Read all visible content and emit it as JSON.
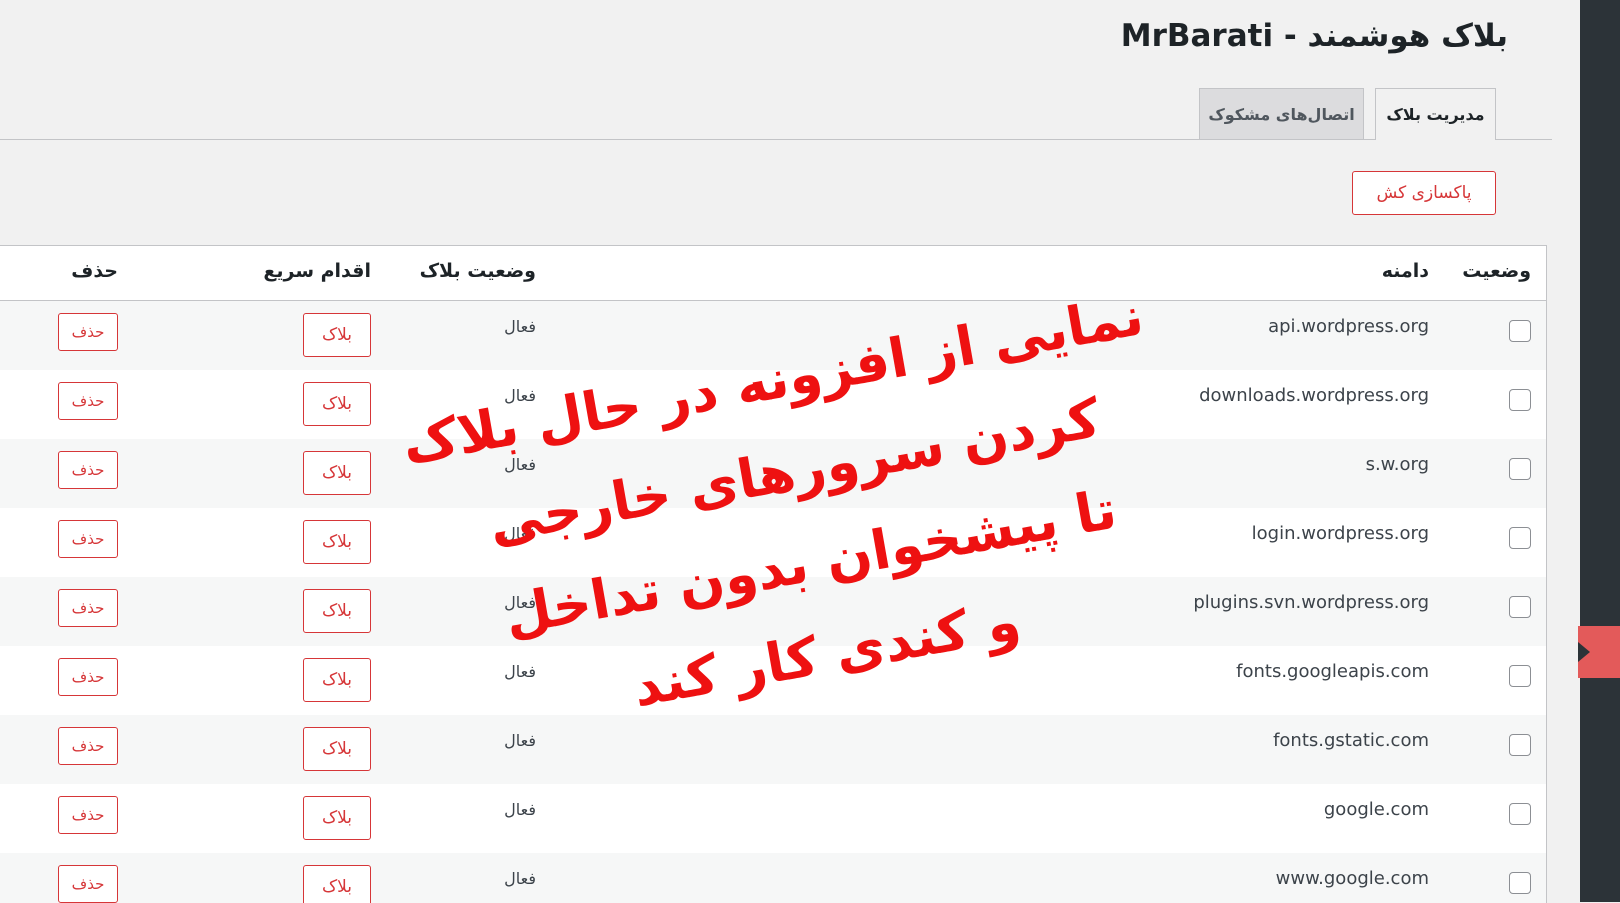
{
  "header": {
    "title": "بلاک هوشمند - MrBarati"
  },
  "tabs": [
    {
      "label": "مدیریت بلاک",
      "active": true
    },
    {
      "label": "اتصال‌های مشکوک",
      "active": false
    }
  ],
  "actions": {
    "purge_cache": "پاکسازی کش"
  },
  "table": {
    "columns": {
      "status": "وضعیت",
      "domain": "دامنه",
      "block_status": "وضعیت بلاک",
      "quick_action": "اقدام سریع",
      "delete": "حذف"
    },
    "rows": [
      {
        "domain": "api.wordpress.org",
        "block_status": "فعال",
        "action": "بلاک",
        "delete": "حذف"
      },
      {
        "domain": "downloads.wordpress.org",
        "block_status": "فعال",
        "action": "بلاک",
        "delete": "حذف"
      },
      {
        "domain": "s.w.org",
        "block_status": "فعال",
        "action": "بلاک",
        "delete": "حذف"
      },
      {
        "domain": "login.wordpress.org",
        "block_status": "فعال",
        "action": "بلاک",
        "delete": "حذف"
      },
      {
        "domain": "plugins.svn.wordpress.org",
        "block_status": "فعال",
        "action": "بلاک",
        "delete": "حذف"
      },
      {
        "domain": "fonts.googleapis.com",
        "block_status": "فعال",
        "action": "بلاک",
        "delete": "حذف"
      },
      {
        "domain": "fonts.gstatic.com",
        "block_status": "فعال",
        "action": "بلاک",
        "delete": "حذف"
      },
      {
        "domain": "google.com",
        "block_status": "فعال",
        "action": "بلاک",
        "delete": "حذف"
      },
      {
        "domain": "www.google.com",
        "block_status": "فعال",
        "action": "بلاک",
        "delete": "حذف"
      }
    ]
  },
  "overlay_caption": {
    "lines": [
      "نمایی از افزونه در حال بلاک",
      "کردن سرورهای خارجی",
      "تا پیشخوان بدون تداخل",
      "و کندی کار کند"
    ],
    "color": "#ee1111"
  },
  "colors": {
    "accent_red": "#d63638",
    "admin_bar": "#2c3338",
    "background": "#f1f1f1"
  }
}
